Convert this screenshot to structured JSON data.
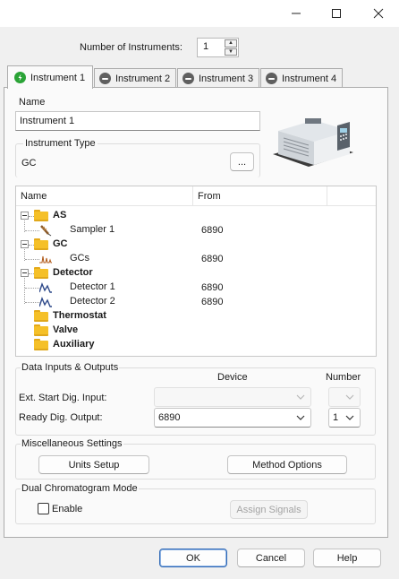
{
  "window": {
    "minimize_label": "minimize",
    "maximize_label": "maximize",
    "close_label": "close"
  },
  "instruments": {
    "label": "Number of Instruments:",
    "value": "1"
  },
  "tabs": [
    {
      "label": "Instrument 1",
      "icon": "check-icon"
    },
    {
      "label": "Instrument 2",
      "icon": "minus-icon"
    },
    {
      "label": "Instrument 3",
      "icon": "minus-icon"
    },
    {
      "label": "Instrument 4",
      "icon": "minus-icon"
    }
  ],
  "name_section": {
    "label": "Name",
    "value": "Instrument 1"
  },
  "instrument_type": {
    "label": "Instrument Type",
    "value": "GC",
    "browse_label": "..."
  },
  "tree": {
    "col_name": "Name",
    "col_from": "From",
    "rows": [
      {
        "label": "AS",
        "from": "",
        "kind": "folder"
      },
      {
        "label": "Sampler 1",
        "from": "6890",
        "kind": "leaf"
      },
      {
        "label": "GC",
        "from": "",
        "kind": "folder"
      },
      {
        "label": "GCs",
        "from": "6890",
        "kind": "leaf"
      },
      {
        "label": "Detector",
        "from": "",
        "kind": "folder"
      },
      {
        "label": "Detector 1",
        "from": "6890",
        "kind": "leaf"
      },
      {
        "label": "Detector 2",
        "from": "6890",
        "kind": "leaf"
      },
      {
        "label": "Thermostat",
        "from": "",
        "kind": "folder"
      },
      {
        "label": "Valve",
        "from": "",
        "kind": "folder"
      },
      {
        "label": "Auxiliary",
        "from": "",
        "kind": "folder"
      }
    ]
  },
  "data_io": {
    "title": "Data Inputs & Outputs",
    "device_header": "Device",
    "number_header": "Number",
    "ext_start_label": "Ext. Start Dig. Input:",
    "ext_start_device": "",
    "ext_start_number": "",
    "ready_label": "Ready Dig. Output:",
    "ready_device": "6890",
    "ready_number": "1"
  },
  "misc": {
    "title": "Miscellaneous Settings",
    "units_setup_label": "Units Setup",
    "method_options_label": "Method Options"
  },
  "dual": {
    "title": "Dual Chromatogram Mode",
    "enable_label": "Enable",
    "enable_checked": false,
    "assign_signals_label": "Assign Signals"
  },
  "footer": {
    "ok_label": "OK",
    "cancel_label": "Cancel",
    "help_label": "Help"
  }
}
